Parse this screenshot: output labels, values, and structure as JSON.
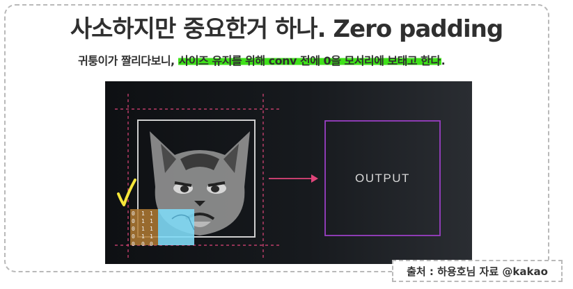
{
  "slide": {
    "title": "사소하지만 중요한거 하나. Zero padding",
    "subtitle_plain": "귀퉁이가 짤리다보니, ",
    "subtitle_highlight": "사이즈 유지를 위해 conv 전에 0을 모서리에 보태고 한다",
    "subtitle_end": ".",
    "highlight_color": "#3fe11a"
  },
  "figure": {
    "output_label": "OUTPUT",
    "padding_column_values": [
      "0",
      "0",
      "0",
      "0",
      "0"
    ],
    "input_column_1": [
      "1",
      "1",
      "1",
      "1",
      "0"
    ],
    "input_column_2": [
      "1",
      "1",
      "1",
      "1",
      "0"
    ],
    "kernel_color": "#7fd9f5",
    "padding_guide_color": "#e0457a",
    "output_border_color": "#9a3fc4",
    "arrow_color": "#e0457a"
  },
  "source": {
    "label": "출처 : 하용호님 자료 @kakao"
  }
}
